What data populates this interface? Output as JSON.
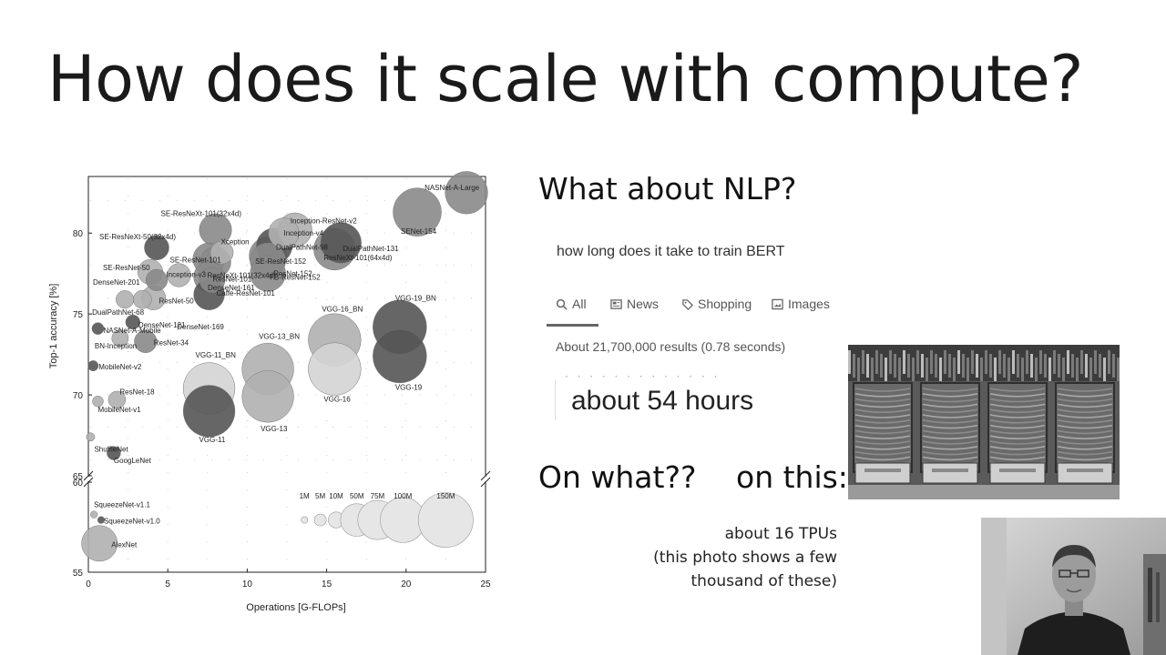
{
  "slide": {
    "title": "How does it scale with compute?",
    "nlp_heading": "What about NLP?",
    "search_query": "how long does it take to train BERT",
    "tabs": [
      {
        "label": "All",
        "icon": "search-icon"
      },
      {
        "label": "News",
        "icon": "news-icon"
      },
      {
        "label": "Shopping",
        "icon": "tag-icon"
      },
      {
        "label": "Images",
        "icon": "image-icon"
      }
    ],
    "results_text": "About 21,700,000 results (0.78 seconds)",
    "answer": "about 54 hours",
    "on_what": "On what??",
    "on_this": "on this:",
    "caption_line1": "about 16 TPUs",
    "caption_line2": "(this photo shows a few",
    "caption_line3": "thousand of these)"
  },
  "chart_data": {
    "type": "scatter",
    "xlabel": "Operations [G-FLOPs]",
    "ylabel": "Top-1 accuracy [%]",
    "xlim": [
      0,
      25
    ],
    "xticks": [
      "0",
      "5",
      "10",
      "15",
      "20",
      "25"
    ],
    "yticks_upper": [
      "65",
      "70",
      "75",
      "80"
    ],
    "yticks_lower": [
      "55",
      "60"
    ],
    "ylim_upper": [
      65,
      83.5
    ],
    "ylim_lower": [
      55,
      60
    ],
    "axis_break": true,
    "grid": "dotted",
    "bubble_size": "parameters",
    "colors": {
      "dark": "#555555",
      "mid": "#8a8a8a",
      "light": "#b0b0b0",
      "pale": "#d4d4d4"
    },
    "points": [
      {
        "name": "NASNet-A-Large",
        "x": 23.8,
        "y": 82.5,
        "params": 88,
        "shade": "mid"
      },
      {
        "name": "SENet-154",
        "x": 20.7,
        "y": 81.3,
        "params": 115,
        "shade": "mid"
      },
      {
        "name": "SE-ResNeXt-101(32x4d)",
        "x": 8.0,
        "y": 80.2,
        "params": 49,
        "shade": "mid"
      },
      {
        "name": "SE-ResNeXt-50(32x4d)",
        "x": 4.3,
        "y": 79.1,
        "params": 27,
        "shade": "dark"
      },
      {
        "name": "Inception-ResNet-v2",
        "x": 13.0,
        "y": 80.2,
        "params": 55,
        "shade": "light"
      },
      {
        "name": "Inception-v4",
        "x": 12.3,
        "y": 80.0,
        "params": 43,
        "shade": "light"
      },
      {
        "name": "DualPathNet-131",
        "x": 15.9,
        "y": 79.4,
        "params": 80,
        "shade": "dark"
      },
      {
        "name": "DualPathNet-98",
        "x": 11.7,
        "y": 79.2,
        "params": 61,
        "shade": "dark"
      },
      {
        "name": "ResNeXt-101(64x4d)",
        "x": 15.5,
        "y": 79.0,
        "params": 84,
        "shade": "mid"
      },
      {
        "name": "Xception",
        "x": 8.4,
        "y": 78.8,
        "params": 23,
        "shade": "light"
      },
      {
        "name": "SE-ResNet-152",
        "x": 11.3,
        "y": 78.6,
        "params": 67,
        "shade": "mid"
      },
      {
        "name": "SE-ResNet-101",
        "x": 7.6,
        "y": 78.4,
        "params": 49,
        "shade": "mid"
      },
      {
        "name": "ResNeXt-101(32x4d)",
        "x": 8.0,
        "y": 78.2,
        "params": 44,
        "shade": "mid"
      },
      {
        "name": "ResNet-152",
        "x": 11.3,
        "y": 78.3,
        "params": 60,
        "shade": "mid"
      },
      {
        "name": "FB-ResNet-152",
        "x": 11.3,
        "y": 77.5,
        "params": 60,
        "shade": "mid"
      },
      {
        "name": "SE-ResNet-50",
        "x": 3.9,
        "y": 77.6,
        "params": 28,
        "shade": "light"
      },
      {
        "name": "Inception-v3",
        "x": 5.7,
        "y": 77.4,
        "params": 24,
        "shade": "light"
      },
      {
        "name": "ResNet-101",
        "x": 7.6,
        "y": 77.3,
        "params": 44,
        "shade": "mid"
      },
      {
        "name": "DenseNet-201",
        "x": 4.3,
        "y": 77.1,
        "params": 20,
        "shade": "mid"
      },
      {
        "name": "DenseNet-161",
        "x": 7.8,
        "y": 77.1,
        "params": 29,
        "shade": "mid"
      },
      {
        "name": "ResNet-50",
        "x": 4.1,
        "y": 76.0,
        "params": 26,
        "shade": "light"
      },
      {
        "name": "Caffe-ResNet-101",
        "x": 7.6,
        "y": 76.2,
        "params": 44,
        "shade": "dark"
      },
      {
        "name": "DenseNet-169",
        "x": 3.4,
        "y": 75.9,
        "params": 14,
        "shade": "light"
      },
      {
        "name": "DualPathNet-68",
        "x": 2.3,
        "y": 75.9,
        "params": 13,
        "shade": "light"
      },
      {
        "name": "DenseNet-121",
        "x": 2.8,
        "y": 74.5,
        "params": 8,
        "shade": "dark"
      },
      {
        "name": "NASNet-A-Mobile",
        "x": 0.6,
        "y": 74.1,
        "params": 5,
        "shade": "dark"
      },
      {
        "name": "BN-Inception",
        "x": 2.0,
        "y": 73.5,
        "params": 11,
        "shade": "light"
      },
      {
        "name": "ResNet-34",
        "x": 3.6,
        "y": 73.3,
        "params": 22,
        "shade": "mid"
      },
      {
        "name": "VGG-19_BN",
        "x": 19.6,
        "y": 74.2,
        "params": 144,
        "shade": "dark"
      },
      {
        "name": "VGG-16_BN",
        "x": 15.5,
        "y": 73.4,
        "params": 138,
        "shade": "light"
      },
      {
        "name": "VGG-19",
        "x": 19.6,
        "y": 72.4,
        "params": 144,
        "shade": "dark"
      },
      {
        "name": "VGG-16",
        "x": 15.5,
        "y": 71.6,
        "params": 138,
        "shade": "pale"
      },
      {
        "name": "VGG-13_BN",
        "x": 11.3,
        "y": 71.6,
        "params": 133,
        "shade": "light"
      },
      {
        "name": "VGG-13",
        "x": 11.3,
        "y": 69.9,
        "params": 133,
        "shade": "light"
      },
      {
        "name": "VGG-11_BN",
        "x": 7.6,
        "y": 70.4,
        "params": 133,
        "shade": "pale"
      },
      {
        "name": "VGG-11",
        "x": 7.6,
        "y": 69.0,
        "params": 133,
        "shade": "dark"
      },
      {
        "name": "MobileNet-v2",
        "x": 0.3,
        "y": 71.8,
        "params": 3.5,
        "shade": "dark"
      },
      {
        "name": "ResNet-18",
        "x": 1.8,
        "y": 69.7,
        "params": 12,
        "shade": "light"
      },
      {
        "name": "MobileNet-v1",
        "x": 0.6,
        "y": 69.6,
        "params": 4,
        "shade": "light"
      },
      {
        "name": "ShuffleNet",
        "x": 0.14,
        "y": 67.4,
        "params": 2,
        "shade": "light"
      },
      {
        "name": "GoogLeNet",
        "x": 1.6,
        "y": 66.4,
        "params": 7,
        "shade": "dark"
      },
      {
        "name": "SqueezeNet-v1.1",
        "x": 0.35,
        "y": 58.2,
        "params": 1.2,
        "shade": "light",
        "panel": "lower"
      },
      {
        "name": "SqueezeNet-v1.0",
        "x": 0.8,
        "y": 57.9,
        "params": 1.2,
        "shade": "dark",
        "panel": "lower"
      },
      {
        "name": "AlexNet",
        "x": 0.7,
        "y": 56.6,
        "params": 61,
        "shade": "light",
        "panel": "lower"
      }
    ],
    "size_legend": [
      {
        "label": "1M",
        "params": 1
      },
      {
        "label": "5M",
        "params": 5
      },
      {
        "label": "10M",
        "params": 10
      },
      {
        "label": "50M",
        "params": 50
      },
      {
        "label": "75M",
        "params": 75
      },
      {
        "label": "100M",
        "params": 100
      },
      {
        "label": "150M",
        "params": 150
      }
    ]
  }
}
